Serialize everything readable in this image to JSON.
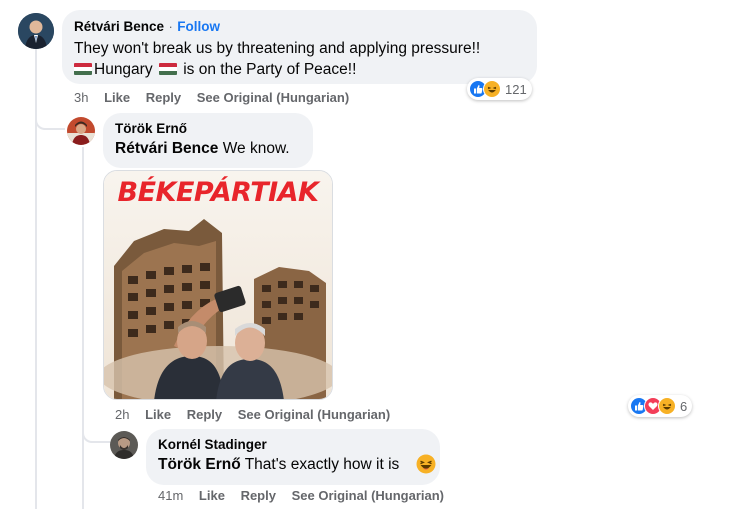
{
  "comments": [
    {
      "author": "Rétvári Bence",
      "follow_label": "Follow",
      "separator": "·",
      "text_line1": "They won't break us by threatening and applying pressure!!",
      "text_line2_pre": "Hungary",
      "text_line2_post": "is on the Party of Peace!!",
      "time": "3h",
      "like_label": "Like",
      "reply_label": "Reply",
      "see_original_label": "See Original (Hungarian)",
      "reactions": [
        "like",
        "haha"
      ],
      "reaction_count": "121"
    },
    {
      "author": "Török Ernő",
      "mention": "Rétvári Bence",
      "text": "We know.",
      "image": {
        "title": "BÉKEPÁRTIAK",
        "description": "Collage image: two men taking a selfie in front of a bombed-out apartment building"
      },
      "time": "2h",
      "like_label": "Like",
      "reply_label": "Reply",
      "see_original_label": "See Original (Hungarian)",
      "reactions": [
        "like",
        "love",
        "haha"
      ],
      "reaction_count": "6"
    },
    {
      "author": "Kornél Stadinger",
      "mention": "Török Ernő",
      "text": "That's exactly how it is",
      "emoji": "laughing-face-emoji",
      "time": "41m",
      "like_label": "Like",
      "reply_label": "Reply",
      "see_original_label": "See Original (Hungarian)"
    }
  ],
  "colors": {
    "bubble": "#f0f2f5",
    "link_blue": "#1877f2",
    "meta_gray": "#65676b",
    "title_red": "#e8252b",
    "like_blue": "#1877f2",
    "love_red": "#f33e58",
    "haha_yellow": "#f7b125"
  }
}
